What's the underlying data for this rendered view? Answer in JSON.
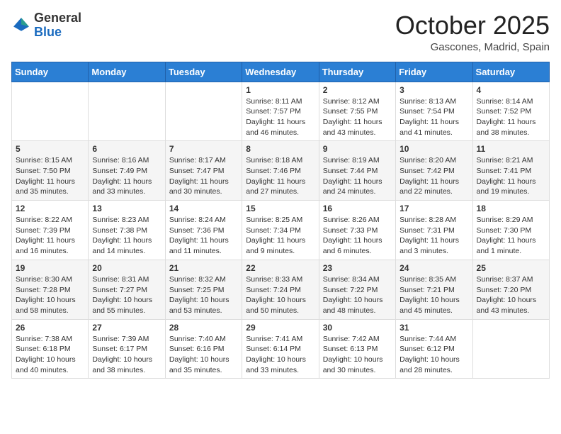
{
  "header": {
    "logo_general": "General",
    "logo_blue": "Blue",
    "month_title": "October 2025",
    "location": "Gascones, Madrid, Spain"
  },
  "days_of_week": [
    "Sunday",
    "Monday",
    "Tuesday",
    "Wednesday",
    "Thursday",
    "Friday",
    "Saturday"
  ],
  "weeks": [
    [
      {
        "day": "",
        "info": ""
      },
      {
        "day": "",
        "info": ""
      },
      {
        "day": "",
        "info": ""
      },
      {
        "day": "1",
        "info": "Sunrise: 8:11 AM\nSunset: 7:57 PM\nDaylight: 11 hours and 46 minutes."
      },
      {
        "day": "2",
        "info": "Sunrise: 8:12 AM\nSunset: 7:55 PM\nDaylight: 11 hours and 43 minutes."
      },
      {
        "day": "3",
        "info": "Sunrise: 8:13 AM\nSunset: 7:54 PM\nDaylight: 11 hours and 41 minutes."
      },
      {
        "day": "4",
        "info": "Sunrise: 8:14 AM\nSunset: 7:52 PM\nDaylight: 11 hours and 38 minutes."
      }
    ],
    [
      {
        "day": "5",
        "info": "Sunrise: 8:15 AM\nSunset: 7:50 PM\nDaylight: 11 hours and 35 minutes."
      },
      {
        "day": "6",
        "info": "Sunrise: 8:16 AM\nSunset: 7:49 PM\nDaylight: 11 hours and 33 minutes."
      },
      {
        "day": "7",
        "info": "Sunrise: 8:17 AM\nSunset: 7:47 PM\nDaylight: 11 hours and 30 minutes."
      },
      {
        "day": "8",
        "info": "Sunrise: 8:18 AM\nSunset: 7:46 PM\nDaylight: 11 hours and 27 minutes."
      },
      {
        "day": "9",
        "info": "Sunrise: 8:19 AM\nSunset: 7:44 PM\nDaylight: 11 hours and 24 minutes."
      },
      {
        "day": "10",
        "info": "Sunrise: 8:20 AM\nSunset: 7:42 PM\nDaylight: 11 hours and 22 minutes."
      },
      {
        "day": "11",
        "info": "Sunrise: 8:21 AM\nSunset: 7:41 PM\nDaylight: 11 hours and 19 minutes."
      }
    ],
    [
      {
        "day": "12",
        "info": "Sunrise: 8:22 AM\nSunset: 7:39 PM\nDaylight: 11 hours and 16 minutes."
      },
      {
        "day": "13",
        "info": "Sunrise: 8:23 AM\nSunset: 7:38 PM\nDaylight: 11 hours and 14 minutes."
      },
      {
        "day": "14",
        "info": "Sunrise: 8:24 AM\nSunset: 7:36 PM\nDaylight: 11 hours and 11 minutes."
      },
      {
        "day": "15",
        "info": "Sunrise: 8:25 AM\nSunset: 7:34 PM\nDaylight: 11 hours and 9 minutes."
      },
      {
        "day": "16",
        "info": "Sunrise: 8:26 AM\nSunset: 7:33 PM\nDaylight: 11 hours and 6 minutes."
      },
      {
        "day": "17",
        "info": "Sunrise: 8:28 AM\nSunset: 7:31 PM\nDaylight: 11 hours and 3 minutes."
      },
      {
        "day": "18",
        "info": "Sunrise: 8:29 AM\nSunset: 7:30 PM\nDaylight: 11 hours and 1 minute."
      }
    ],
    [
      {
        "day": "19",
        "info": "Sunrise: 8:30 AM\nSunset: 7:28 PM\nDaylight: 10 hours and 58 minutes."
      },
      {
        "day": "20",
        "info": "Sunrise: 8:31 AM\nSunset: 7:27 PM\nDaylight: 10 hours and 55 minutes."
      },
      {
        "day": "21",
        "info": "Sunrise: 8:32 AM\nSunset: 7:25 PM\nDaylight: 10 hours and 53 minutes."
      },
      {
        "day": "22",
        "info": "Sunrise: 8:33 AM\nSunset: 7:24 PM\nDaylight: 10 hours and 50 minutes."
      },
      {
        "day": "23",
        "info": "Sunrise: 8:34 AM\nSunset: 7:22 PM\nDaylight: 10 hours and 48 minutes."
      },
      {
        "day": "24",
        "info": "Sunrise: 8:35 AM\nSunset: 7:21 PM\nDaylight: 10 hours and 45 minutes."
      },
      {
        "day": "25",
        "info": "Sunrise: 8:37 AM\nSunset: 7:20 PM\nDaylight: 10 hours and 43 minutes."
      }
    ],
    [
      {
        "day": "26",
        "info": "Sunrise: 7:38 AM\nSunset: 6:18 PM\nDaylight: 10 hours and 40 minutes."
      },
      {
        "day": "27",
        "info": "Sunrise: 7:39 AM\nSunset: 6:17 PM\nDaylight: 10 hours and 38 minutes."
      },
      {
        "day": "28",
        "info": "Sunrise: 7:40 AM\nSunset: 6:16 PM\nDaylight: 10 hours and 35 minutes."
      },
      {
        "day": "29",
        "info": "Sunrise: 7:41 AM\nSunset: 6:14 PM\nDaylight: 10 hours and 33 minutes."
      },
      {
        "day": "30",
        "info": "Sunrise: 7:42 AM\nSunset: 6:13 PM\nDaylight: 10 hours and 30 minutes."
      },
      {
        "day": "31",
        "info": "Sunrise: 7:44 AM\nSunset: 6:12 PM\nDaylight: 10 hours and 28 minutes."
      },
      {
        "day": "",
        "info": ""
      }
    ]
  ]
}
